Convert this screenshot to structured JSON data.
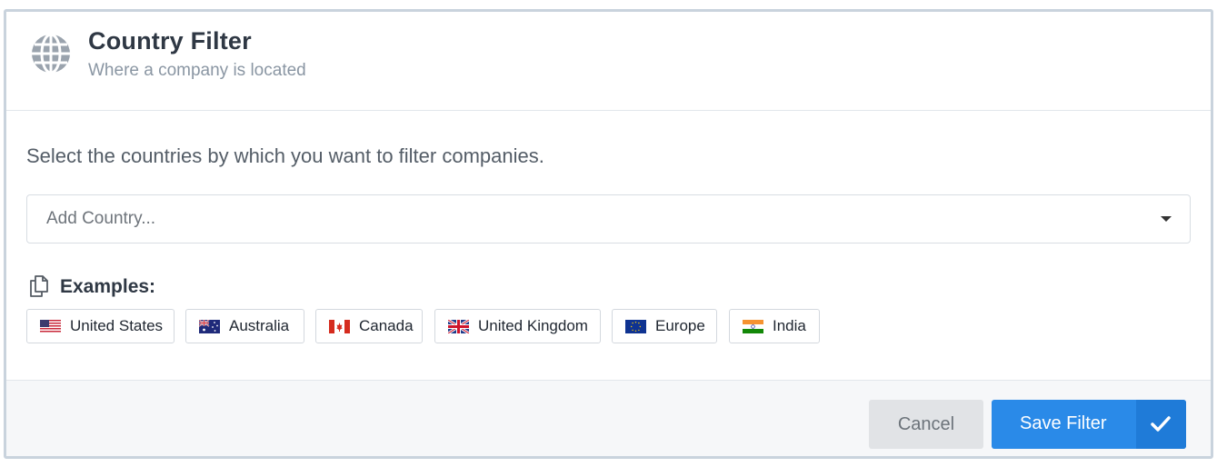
{
  "header": {
    "icon": "globe-icon",
    "title": "Country Filter",
    "subtitle": "Where a company is located"
  },
  "body": {
    "instruction": "Select the countries by which you want to filter companies.",
    "country_select": {
      "placeholder": "Add Country...",
      "icon": "caret-down-icon"
    },
    "examples": {
      "icon": "copy-icon",
      "label": "Examples:",
      "items": [
        {
          "label": "United States",
          "flag": "us-flag-icon"
        },
        {
          "label": "Australia",
          "flag": "au-flag-icon"
        },
        {
          "label": "Canada",
          "flag": "ca-flag-icon"
        },
        {
          "label": "United Kingdom",
          "flag": "gb-flag-icon"
        },
        {
          "label": "Europe",
          "flag": "eu-flag-icon"
        },
        {
          "label": "India",
          "flag": "in-flag-icon"
        }
      ]
    }
  },
  "footer": {
    "cancel_label": "Cancel",
    "save_label": "Save Filter",
    "save_icon": "check-icon"
  },
  "colors": {
    "primary": "#2a8ae8",
    "primary_dark": "#1f7bd8",
    "cancel_bg": "#e1e3e6",
    "footer_bg": "#f6f7f9",
    "border": "#c9d3dd"
  }
}
